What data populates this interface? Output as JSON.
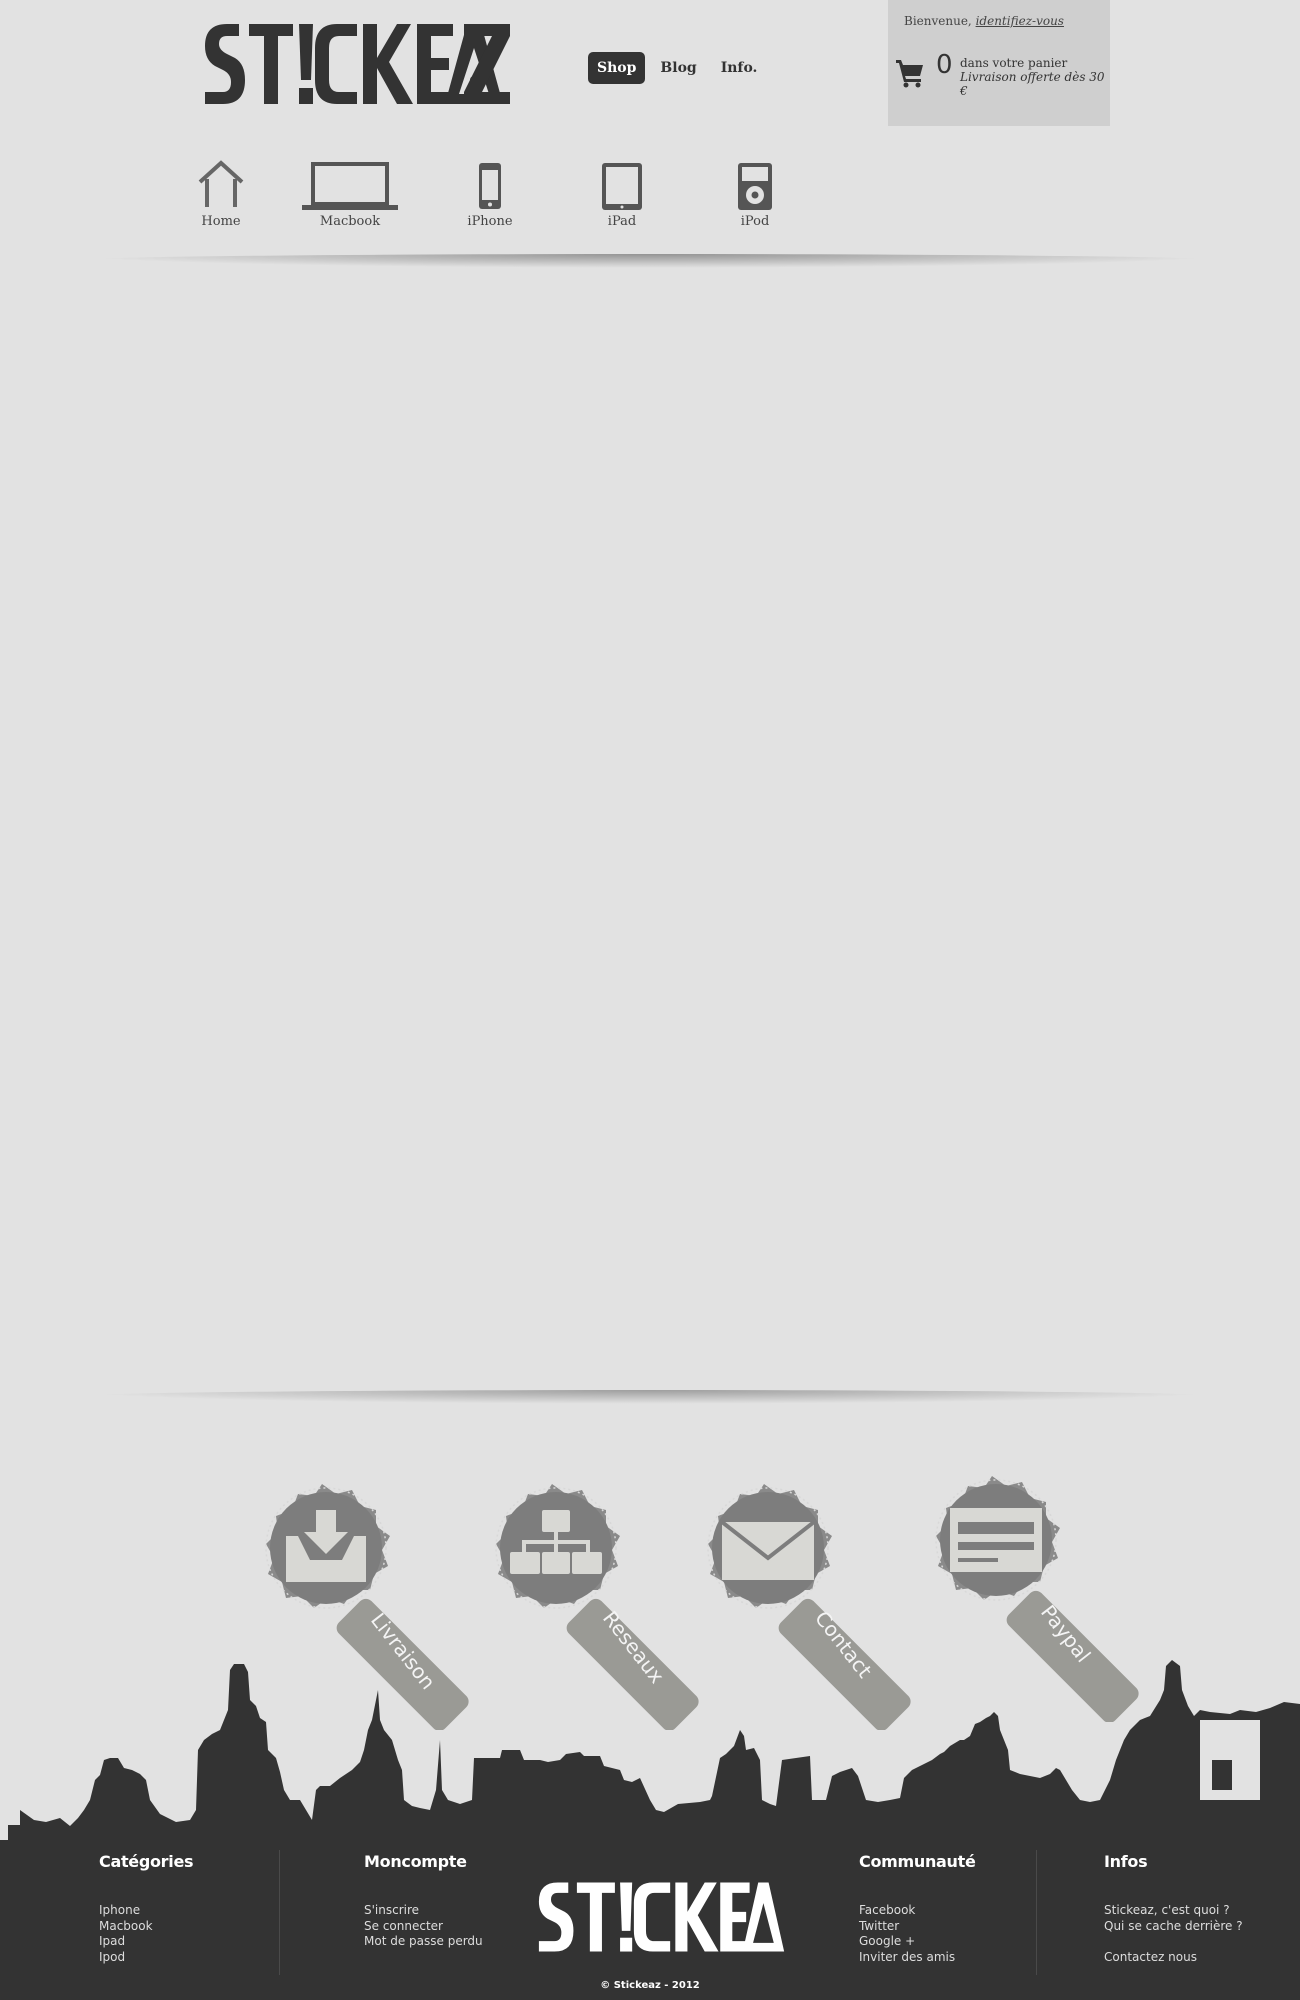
{
  "brand": {
    "logo_text": "ST!CKEAZ"
  },
  "topnav": {
    "items": [
      {
        "label": "Shop",
        "active": true
      },
      {
        "label": "Blog",
        "active": false
      },
      {
        "label": "Info.",
        "active": false
      }
    ]
  },
  "account": {
    "welcome": "Bienvenue,",
    "login_link": "identifiez-vous"
  },
  "cart": {
    "count": "0",
    "text": "dans votre panier",
    "shipping": "Livraison offerte dès 30 €"
  },
  "devices": [
    {
      "label": "Home",
      "icon": "home-icon"
    },
    {
      "label": "Macbook",
      "icon": "laptop-icon"
    },
    {
      "label": "iPhone",
      "icon": "phone-icon"
    },
    {
      "label": "iPad",
      "icon": "tablet-icon"
    },
    {
      "label": "iPod",
      "icon": "ipod-icon"
    }
  ],
  "badges": [
    {
      "label": "Livraison",
      "icon": "inbox-download-icon"
    },
    {
      "label": "Reseaux",
      "icon": "network-icon"
    },
    {
      "label": "Contact",
      "icon": "envelope-icon"
    },
    {
      "label": "Paypal",
      "icon": "credit-card-icon"
    }
  ],
  "footer": {
    "columns": [
      {
        "title": "Catégories",
        "links": [
          "Iphone",
          "Macbook",
          "Ipad",
          "Ipod"
        ]
      },
      {
        "title": "Moncompte",
        "links": [
          "S'inscrire",
          "Se connecter",
          "Mot de passe perdu"
        ]
      },
      {
        "title": "Communauté",
        "links": [
          "Facebook",
          "Twitter",
          "Google +",
          "Inviter des amis"
        ]
      },
      {
        "title": "Infos",
        "links": [
          "Stickeaz, c'est quoi ?",
          "Qui se cache derrière ?",
          "Contactez nous"
        ]
      }
    ],
    "logo_text": "ST!CKEAZ",
    "copyright": "© Stickeaz - 2012"
  },
  "colors": {
    "background": "#e2e2e2",
    "dark": "#333333",
    "badge": "#8a8a8a",
    "badge_tag": "#9a9a95"
  }
}
